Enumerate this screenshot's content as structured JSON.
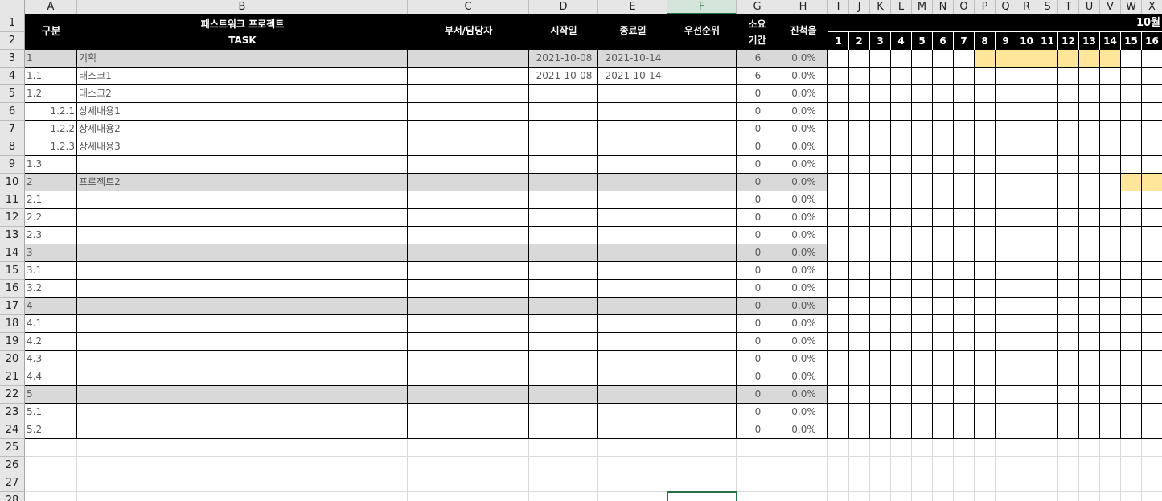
{
  "columns": [
    "A",
    "B",
    "C",
    "D",
    "E",
    "F",
    "G",
    "H",
    "I",
    "J",
    "K",
    "L",
    "M",
    "N",
    "O",
    "P",
    "Q",
    "R",
    "S",
    "T",
    "U",
    "V",
    "W",
    "X"
  ],
  "selected_column": "F",
  "row_numbers": [
    "1",
    "2",
    "3",
    "4",
    "5",
    "6",
    "7",
    "8",
    "9",
    "10",
    "11",
    "12",
    "13",
    "14",
    "15",
    "16",
    "17",
    "18",
    "19",
    "20",
    "21",
    "22",
    "23",
    "24",
    "25",
    "26",
    "27",
    "28"
  ],
  "headers": {
    "category": "구분",
    "project_title": "패스트워크 프로젝트",
    "task": "TASK",
    "owner": "부서/담당자",
    "start": "시작일",
    "end": "종료일",
    "priority": "우선순위",
    "duration_l1": "소요",
    "duration_l2": "기간",
    "progress": "진척율",
    "month": "10월",
    "days": [
      "1",
      "2",
      "3",
      "4",
      "5",
      "6",
      "7",
      "8",
      "9",
      "10",
      "11",
      "12",
      "13",
      "14",
      "15",
      "16"
    ]
  },
  "rows": [
    {
      "no": "1",
      "task": "기획",
      "start": "2021-10-08",
      "end": "2021-10-14",
      "duration": "6",
      "progress": "0.0%",
      "group": true,
      "indent": false,
      "gantt": [
        8,
        9,
        10,
        11,
        12,
        13,
        14
      ]
    },
    {
      "no": "1.1",
      "task": "태스크1",
      "start": "2021-10-08",
      "end": "2021-10-14",
      "duration": "6",
      "progress": "0.0%",
      "group": false,
      "indent": false,
      "gantt": []
    },
    {
      "no": "1.2",
      "task": "태스크2",
      "start": "",
      "end": "",
      "duration": "0",
      "progress": "0.0%",
      "group": false,
      "indent": false,
      "gantt": []
    },
    {
      "no": "1.2.1",
      "task": "상세내용1",
      "start": "",
      "end": "",
      "duration": "0",
      "progress": "0.0%",
      "group": false,
      "indent": true,
      "gantt": []
    },
    {
      "no": "1.2.2",
      "task": "상세내용2",
      "start": "",
      "end": "",
      "duration": "0",
      "progress": "0.0%",
      "group": false,
      "indent": true,
      "gantt": []
    },
    {
      "no": "1.2.3",
      "task": "상세내용3",
      "start": "",
      "end": "",
      "duration": "0",
      "progress": "0.0%",
      "group": false,
      "indent": true,
      "gantt": []
    },
    {
      "no": "1.3",
      "task": "",
      "start": "",
      "end": "",
      "duration": "0",
      "progress": "0.0%",
      "group": false,
      "indent": false,
      "gantt": []
    },
    {
      "no": "2",
      "task": "프로젝트2",
      "start": "",
      "end": "",
      "duration": "0",
      "progress": "0.0%",
      "group": true,
      "indent": false,
      "gantt": [
        15,
        16
      ]
    },
    {
      "no": "2.1",
      "task": "",
      "start": "",
      "end": "",
      "duration": "0",
      "progress": "0.0%",
      "group": false,
      "indent": false,
      "gantt": []
    },
    {
      "no": "2.2",
      "task": "",
      "start": "",
      "end": "",
      "duration": "0",
      "progress": "0.0%",
      "group": false,
      "indent": false,
      "gantt": []
    },
    {
      "no": "2.3",
      "task": "",
      "start": "",
      "end": "",
      "duration": "0",
      "progress": "0.0%",
      "group": false,
      "indent": false,
      "gantt": []
    },
    {
      "no": "3",
      "task": "",
      "start": "",
      "end": "",
      "duration": "0",
      "progress": "0.0%",
      "group": true,
      "indent": false,
      "gantt": []
    },
    {
      "no": "3.1",
      "task": "",
      "start": "",
      "end": "",
      "duration": "0",
      "progress": "0.0%",
      "group": false,
      "indent": false,
      "gantt": []
    },
    {
      "no": "3.2",
      "task": "",
      "start": "",
      "end": "",
      "duration": "0",
      "progress": "0.0%",
      "group": false,
      "indent": false,
      "gantt": []
    },
    {
      "no": "4",
      "task": "",
      "start": "",
      "end": "",
      "duration": "0",
      "progress": "0.0%",
      "group": true,
      "indent": false,
      "gantt": []
    },
    {
      "no": "4.1",
      "task": "",
      "start": "",
      "end": "",
      "duration": "0",
      "progress": "0.0%",
      "group": false,
      "indent": false,
      "gantt": []
    },
    {
      "no": "4.2",
      "task": "",
      "start": "",
      "end": "",
      "duration": "0",
      "progress": "0.0%",
      "group": false,
      "indent": false,
      "gantt": []
    },
    {
      "no": "4.3",
      "task": "",
      "start": "",
      "end": "",
      "duration": "0",
      "progress": "0.0%",
      "group": false,
      "indent": false,
      "gantt": []
    },
    {
      "no": "4.4",
      "task": "",
      "start": "",
      "end": "",
      "duration": "0",
      "progress": "0.0%",
      "group": false,
      "indent": false,
      "gantt": []
    },
    {
      "no": "5",
      "task": "",
      "start": "",
      "end": "",
      "duration": "0",
      "progress": "0.0%",
      "group": true,
      "indent": false,
      "gantt": []
    },
    {
      "no": "5.1",
      "task": "",
      "start": "",
      "end": "",
      "duration": "0",
      "progress": "0.0%",
      "group": false,
      "indent": false,
      "gantt": []
    },
    {
      "no": "5.2",
      "task": "",
      "start": "",
      "end": "",
      "duration": "0",
      "progress": "0.0%",
      "group": false,
      "indent": false,
      "gantt": []
    }
  ],
  "colors": {
    "header_bg": "#000000",
    "group_row": "#d9d9d9",
    "gantt_fill": "#ffe699",
    "selection": "#217346"
  }
}
